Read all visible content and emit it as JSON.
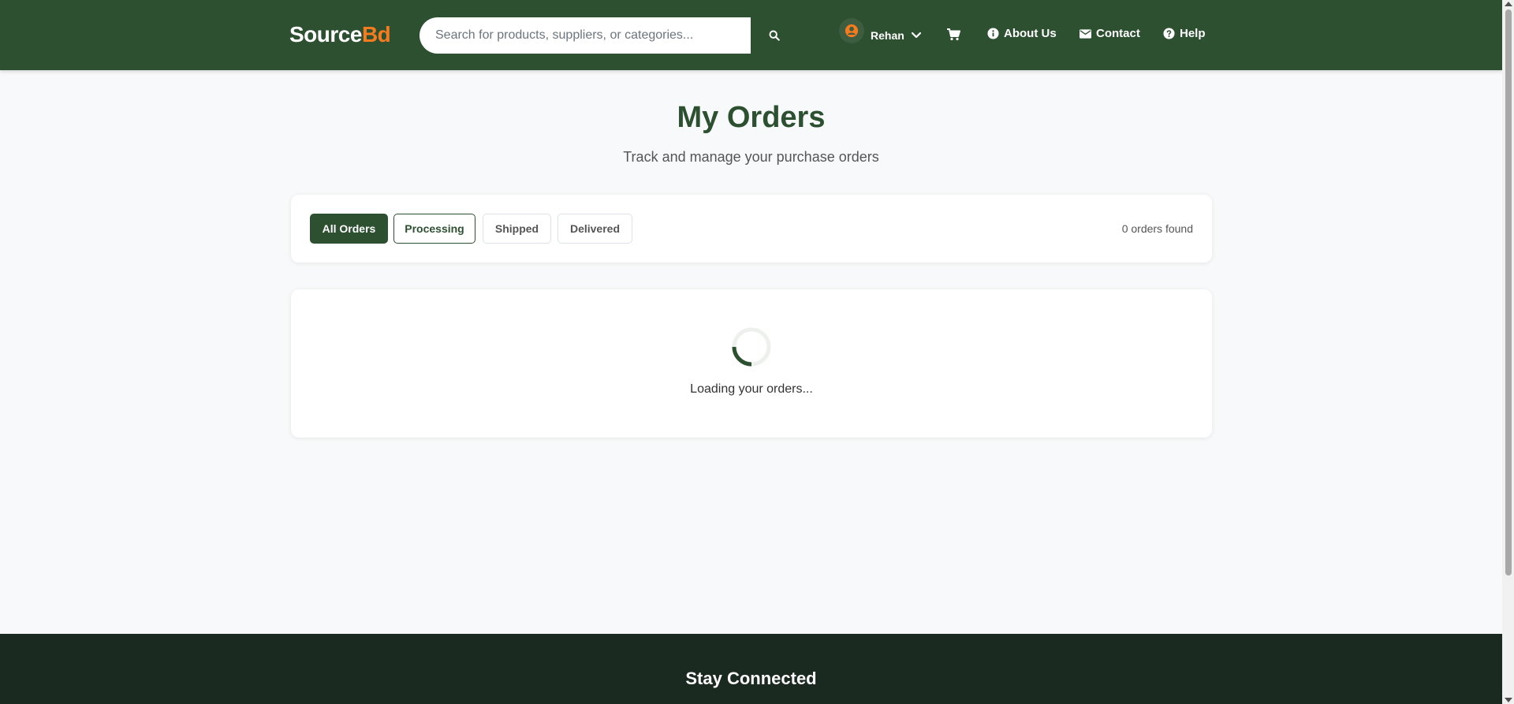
{
  "header": {
    "logo_main": "Source",
    "logo_accent": "Bd",
    "search_placeholder": "Search for products, suppliers, or categories...",
    "user_name": "Rehan",
    "nav": {
      "about": "About Us",
      "contact": "Contact",
      "help": "Help"
    }
  },
  "main": {
    "title": "My Orders",
    "subtitle": "Track and manage your purchase orders",
    "filters": [
      {
        "label": "All Orders",
        "state": "active"
      },
      {
        "label": "Processing",
        "state": "outline"
      },
      {
        "label": "Shipped",
        "state": "plain"
      },
      {
        "label": "Delivered",
        "state": "plain"
      }
    ],
    "order_count": "0 orders found",
    "loading_text": "Loading your orders..."
  },
  "footer": {
    "title": "Stay Connected"
  },
  "colors": {
    "brand_green": "#2d5031",
    "accent_orange": "#f47b20",
    "footer_dark": "#1b2a21"
  },
  "icons": {
    "search": "search-icon",
    "user": "user-circle-icon",
    "chevron": "chevron-down-icon",
    "cart": "cart-icon",
    "about": "info-icon",
    "contact": "envelope-icon",
    "help": "question-icon"
  }
}
